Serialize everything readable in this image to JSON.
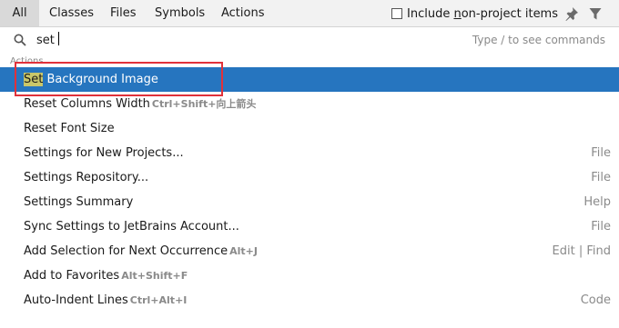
{
  "tabs": [
    {
      "label": "All",
      "selected": true
    },
    {
      "label": "Classes",
      "selected": false
    },
    {
      "label": "Files",
      "selected": false
    },
    {
      "label": "Symbols",
      "selected": false
    },
    {
      "label": "Actions",
      "selected": false
    }
  ],
  "include_checkbox": {
    "label_pre": "Include ",
    "label_mnemonic": "n",
    "label_post": "on-project items",
    "checked": false
  },
  "search": {
    "query": "set",
    "hint": "Type / to see commands"
  },
  "section_label": "Actions",
  "results": [
    {
      "match": "Set",
      "rest": " Background Image",
      "shortcut": "",
      "group": "",
      "selected": true
    },
    {
      "match": "",
      "rest": "Reset Columns Width",
      "shortcut": "Ctrl+Shift+向上箭头",
      "group": "",
      "selected": false
    },
    {
      "match": "",
      "rest": "Reset Font Size",
      "shortcut": "",
      "group": "",
      "selected": false
    },
    {
      "match": "",
      "rest": "Settings for New Projects...",
      "shortcut": "",
      "group": "File",
      "selected": false
    },
    {
      "match": "",
      "rest": "Settings Repository...",
      "shortcut": "",
      "group": "File",
      "selected": false
    },
    {
      "match": "",
      "rest": "Settings Summary",
      "shortcut": "",
      "group": "Help",
      "selected": false
    },
    {
      "match": "",
      "rest": "Sync Settings to JetBrains Account...",
      "shortcut": "",
      "group": "File",
      "selected": false
    },
    {
      "match": "",
      "rest": "Add Selection for Next Occurrence",
      "shortcut": "Alt+J",
      "group": "Edit | Find",
      "selected": false
    },
    {
      "match": "",
      "rest": "Add to Favorites",
      "shortcut": "Alt+Shift+F",
      "group": "",
      "selected": false
    },
    {
      "match": "",
      "rest": "Auto-Indent Lines",
      "shortcut": "Ctrl+Alt+I",
      "group": "Code",
      "selected": false
    }
  ],
  "icons": {
    "pin": "pin-icon",
    "filter": "filter-icon",
    "search": "search-icon"
  },
  "colors": {
    "selection": "#2675bf",
    "highlight": "#c9c76a",
    "annotation_box": "#e0313a"
  }
}
